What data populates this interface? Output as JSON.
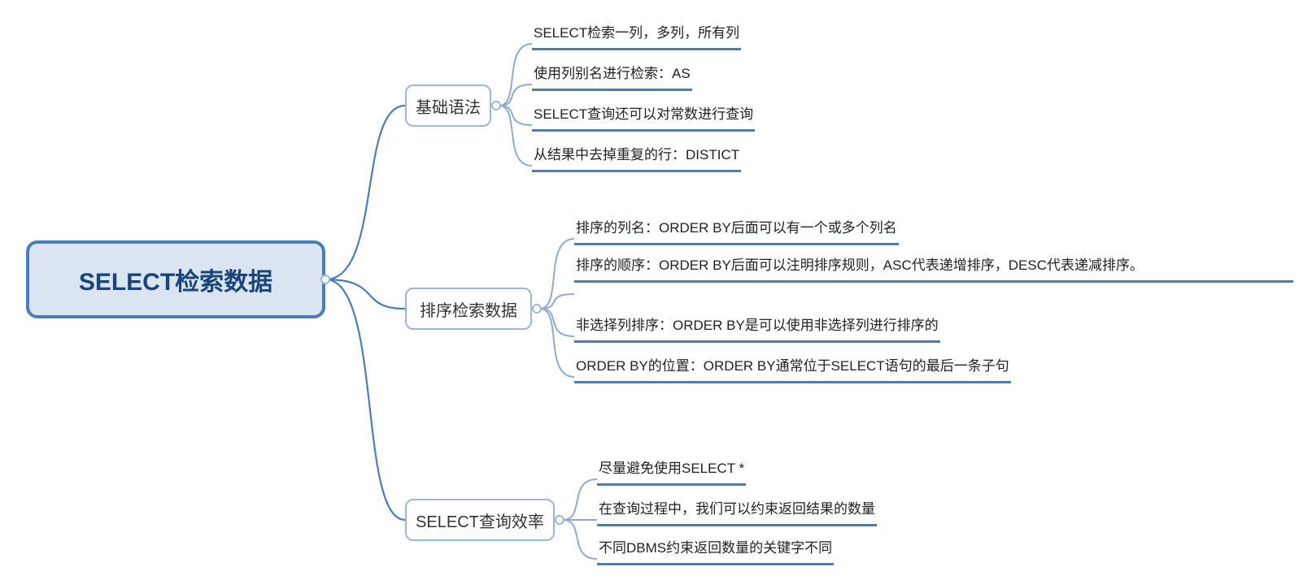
{
  "root": {
    "label": "SELECT检索数据"
  },
  "branch1": {
    "label": "基础语法",
    "leaves": [
      "SELECT检索一列，多列，所有列",
      "使用列别名进行检索：AS",
      "SELECT查询还可以对常数进行查询",
      "从结果中去掉重复的行：DISTICT"
    ]
  },
  "branch2": {
    "label": "排序检索数据",
    "leaves": [
      "排序的列名：ORDER BY后面可以有一个或多个列名",
      "排序的顺序：ORDER BY后面可以注明排序规则，ASC代表递增排序，DESC代表递减排序。",
      "非选择列排序：ORDER BY是可以使用非选择列进行排序的",
      "ORDER BY的位置：ORDER BY通常位于SELECT语句的最后一条子句"
    ]
  },
  "branch3": {
    "label": "SELECT查询效率",
    "leaves": [
      "尽量避免使用SELECT *",
      "在查询过程中，我们可以约束返回结果的数量",
      "不同DBMS约束返回数量的关键字不同"
    ]
  }
}
